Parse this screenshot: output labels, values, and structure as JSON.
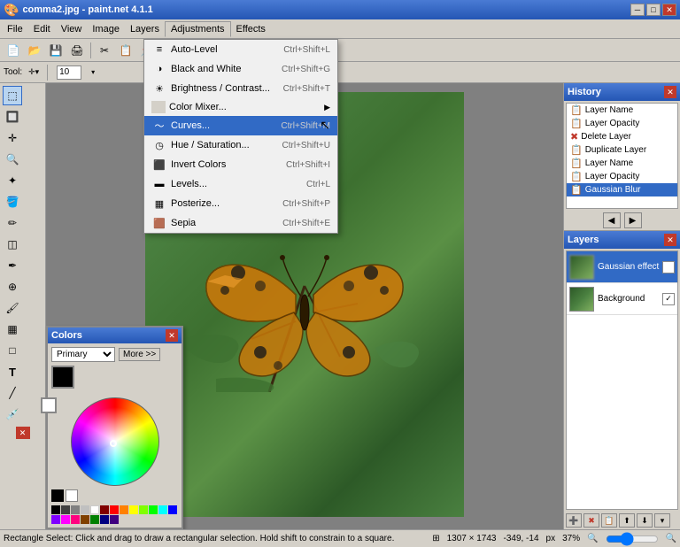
{
  "titlebar": {
    "title": "comma2.jpg - paint.net 4.1.1",
    "controls": [
      "minimize",
      "maximize",
      "close"
    ]
  },
  "menubar": {
    "items": [
      "File",
      "Edit",
      "View",
      "Image",
      "Layers",
      "Adjustments",
      "Effects"
    ]
  },
  "adjustments_menu": {
    "items": [
      {
        "label": "Auto-Level",
        "shortcut": "Ctrl+Shift+L",
        "icon": "≡"
      },
      {
        "label": "Black and White",
        "shortcut": "Ctrl+Shift+G",
        "icon": "◑"
      },
      {
        "label": "Brightness / Contrast...",
        "shortcut": "Ctrl+Shift+T",
        "icon": "☀"
      },
      {
        "label": "Color Mixer...",
        "shortcut": "",
        "icon": "🎨",
        "has_arrow": true
      },
      {
        "label": "Curves...",
        "shortcut": "Ctrl+Shift+M",
        "icon": "〜",
        "highlighted": true
      },
      {
        "label": "Hue / Saturation...",
        "shortcut": "Ctrl+Shift+U",
        "icon": "◷"
      },
      {
        "label": "Invert Colors",
        "shortcut": "Ctrl+Shift+I",
        "icon": "⬛"
      },
      {
        "label": "Levels...",
        "shortcut": "Ctrl+L",
        "icon": "📊"
      },
      {
        "label": "Posterize...",
        "shortcut": "Ctrl+Shift+P",
        "icon": "▦"
      },
      {
        "label": "Sepia",
        "shortcut": "Ctrl+Shift+E",
        "icon": "🟫"
      }
    ]
  },
  "history": {
    "title": "History",
    "items": [
      {
        "label": "Layer Name",
        "icon": "📋"
      },
      {
        "label": "Layer Opacity",
        "icon": "📋"
      },
      {
        "label": "Delete Layer",
        "icon": "✖",
        "red": true
      },
      {
        "label": "Duplicate Layer",
        "icon": "📋"
      },
      {
        "label": "Layer Name",
        "icon": "📋"
      },
      {
        "label": "Layer Opacity",
        "icon": "📋"
      },
      {
        "label": "Gaussian Blur",
        "icon": "📋",
        "selected": true
      }
    ],
    "undo_label": "◀",
    "redo_label": "▶"
  },
  "layers": {
    "title": "Layers",
    "items": [
      {
        "name": "Gaussian effect",
        "type": "gaussian",
        "checked": true
      },
      {
        "name": "Background",
        "type": "background",
        "checked": true
      }
    ],
    "toolbar_buttons": [
      "➕",
      "✖",
      "📋",
      "⬆",
      "⬇",
      "🔽"
    ]
  },
  "colors": {
    "title": "Colors",
    "mode": "Primary",
    "more_button": "More >>",
    "palette": [
      "#000000",
      "#404040",
      "#808080",
      "#c0c0c0",
      "#ffffff",
      "#ff0000",
      "#ff8000",
      "#ffff00",
      "#00ff00",
      "#00ffff",
      "#0000ff",
      "#8000ff",
      "#ff00ff",
      "#804000",
      "#008000"
    ]
  },
  "status": {
    "text": "Rectangle Select: Click and drag to draw a rectangular selection. Hold shift to constrain to a square.",
    "dimensions": "1307 × 1743",
    "coords": "-349, -14",
    "unit": "px",
    "zoom": "37%"
  },
  "toolbar2": {
    "size_value": "10"
  }
}
